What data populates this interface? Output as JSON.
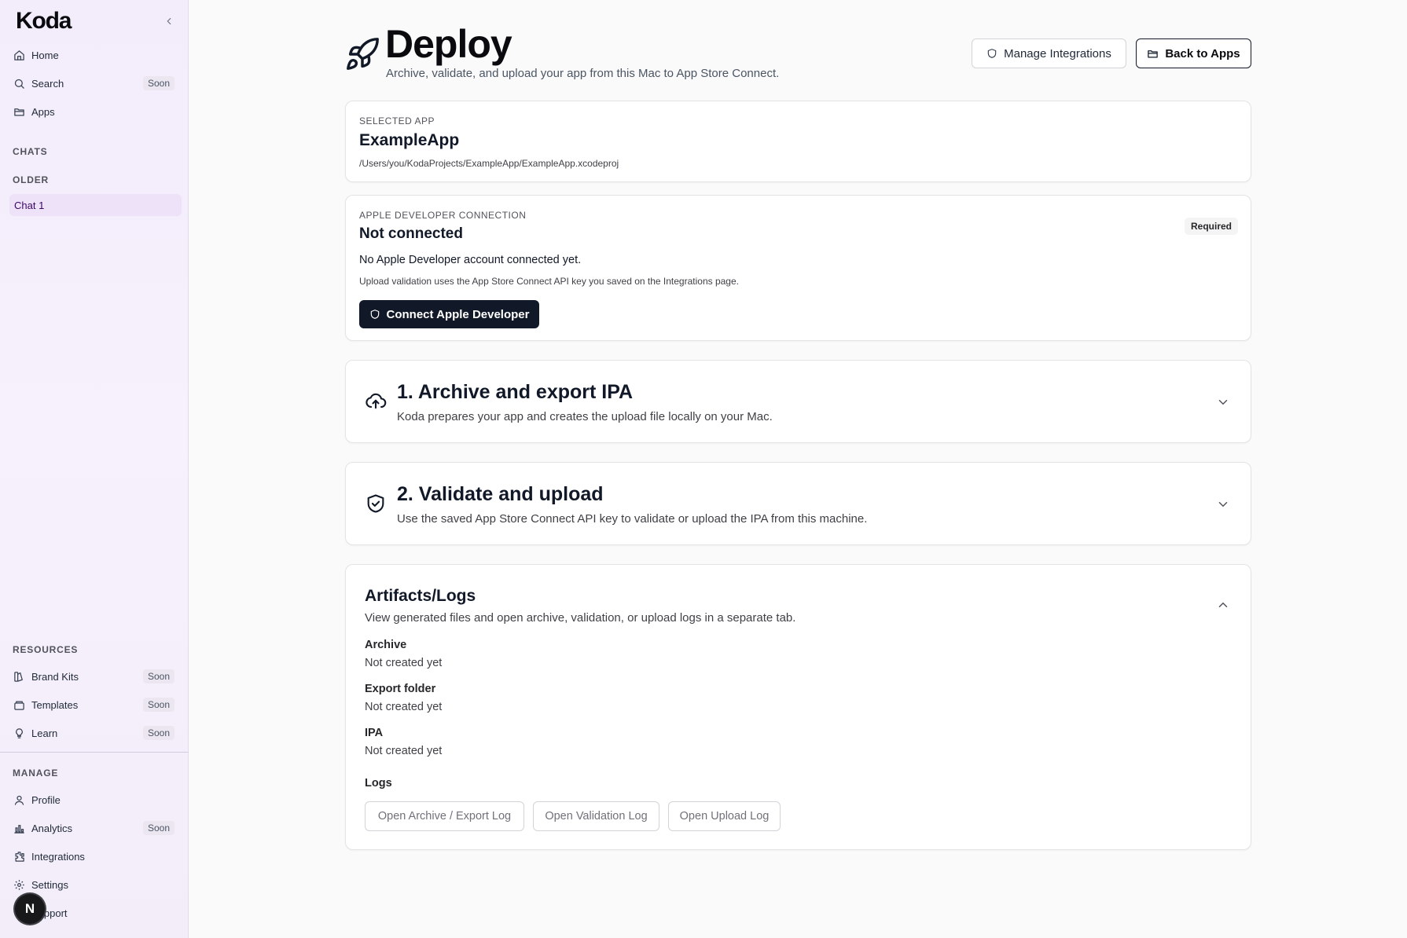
{
  "sidebar": {
    "logo": "Koda",
    "nav": [
      {
        "label": "Home",
        "icon": "home-icon"
      },
      {
        "label": "Search",
        "icon": "search-icon",
        "badge": "Soon"
      },
      {
        "label": "Apps",
        "icon": "folder-icon"
      }
    ],
    "chats_title": "CHATS",
    "older_title": "OLDER",
    "chats": [
      {
        "label": "Chat 1"
      }
    ],
    "resources_title": "RESOURCES",
    "resources": [
      {
        "label": "Brand Kits",
        "icon": "brand-kit-icon",
        "badge": "Soon"
      },
      {
        "label": "Templates",
        "icon": "templates-icon",
        "badge": "Soon"
      },
      {
        "label": "Learn",
        "icon": "lightbulb-icon",
        "badge": "Soon"
      }
    ],
    "manage_title": "MANAGE",
    "manage": [
      {
        "label": "Profile",
        "icon": "user-icon"
      },
      {
        "label": "Analytics",
        "icon": "bar-chart-icon",
        "badge": "Soon"
      },
      {
        "label": "Integrations",
        "icon": "puzzle-icon"
      },
      {
        "label": "Settings",
        "icon": "gear-icon"
      },
      {
        "label": "Support",
        "icon": "help-icon"
      }
    ],
    "avatar_letter": "N"
  },
  "header": {
    "title": "Deploy",
    "subtitle": "Archive, validate, and upload your app from this Mac to App Store Connect.",
    "manage_label": "Manage Integrations",
    "back_label": "Back to Apps"
  },
  "selected_app": {
    "eyebrow": "SELECTED APP",
    "name": "ExampleApp",
    "path": "/Users/you/KodaProjects/ExampleApp/ExampleApp.xcodeproj"
  },
  "developer": {
    "eyebrow": "APPLE DEVELOPER CONNECTION",
    "status": "Not connected",
    "required": "Required",
    "desc": "No Apple Developer account connected yet.",
    "note": "Upload validation uses the App Store Connect API key you saved on the Integrations page.",
    "connect_label": "Connect Apple Developer"
  },
  "steps": [
    {
      "title": "1. Archive and export IPA",
      "desc": "Koda prepares your app and creates the upload file locally on your Mac."
    },
    {
      "title": "2. Validate and upload",
      "desc": "Use the saved App Store Connect API key to validate or upload the IPA from this machine."
    }
  ],
  "artifacts": {
    "title": "Artifacts/Logs",
    "desc": "View generated files and open archive, validation, or upload logs in a separate tab.",
    "items": [
      {
        "label": "Archive",
        "value": "Not created yet"
      },
      {
        "label": "Export folder",
        "value": "Not created yet"
      },
      {
        "label": "IPA",
        "value": "Not created yet"
      }
    ],
    "logs_title": "Logs",
    "log_buttons": [
      "Open Archive / Export Log",
      "Open Validation Log",
      "Open Upload Log"
    ]
  },
  "colors": {
    "accent": "#111827",
    "sidebar_bg": "#f3ecfb",
    "chat_active": "#ede2f8"
  }
}
